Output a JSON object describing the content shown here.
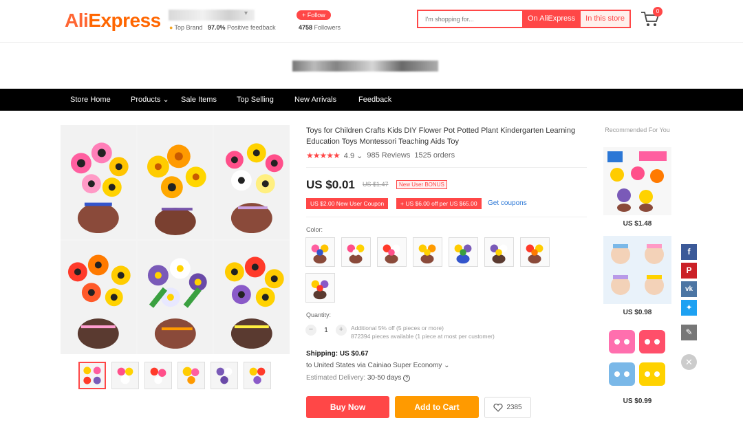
{
  "header": {
    "logo_part1": "Ali",
    "logo_part2": "Express",
    "store_caret": "▾",
    "top_brand": "Top Brand",
    "positive_pct": "97.0%",
    "positive_label": "Positive feedback",
    "follow_label": "+ Follow",
    "followers_count": "4758",
    "followers_label": "Followers",
    "search_placeholder": "I'm shopping for...",
    "on_aliexpress": "On AliExpress",
    "in_this_store": "In this store",
    "cart_count": "0"
  },
  "nav": {
    "items": [
      "Store Home",
      "Products",
      "Sale Items",
      "Top Selling",
      "New Arrivals",
      "Feedback"
    ]
  },
  "product": {
    "title": "Toys for Children Crafts Kids DIY Flower Pot Potted Plant Kindergarten Learning Education Toys Montessori Teaching Aids Toy",
    "stars": "★★★★★",
    "rating": "4.9",
    "reviews": "985 Reviews",
    "orders": "1525 orders",
    "price": "US $0.01",
    "old_price": "US $1.47",
    "bonus": "New User BONUS",
    "coupon_new_user": "US $2.00 New User Coupon",
    "coupon_off": "+ US $6.00 off per US $65.00",
    "get_coupons": "Get coupons",
    "color_label": "Color:",
    "quantity_label": "Quantity:",
    "quantity": "1",
    "qty_note1": "Additional 5% off (5 pieces or more)",
    "qty_note2": "872394 pieces available (1 piece at most per customer)",
    "shipping": "Shipping: US $0.67",
    "ship_to": "to United States via Cainiao Super Economy ⌄",
    "delivery_label": "Estimated Delivery:",
    "delivery_value": "30-50 days",
    "buy_now": "Buy Now",
    "add_to_cart": "Add to Cart",
    "wishlist_count": "2385"
  },
  "recommended": {
    "title": "Recommended For You",
    "items": [
      {
        "price": "US $1.48"
      },
      {
        "price": "US $0.98"
      },
      {
        "price": "US $0.99"
      }
    ]
  },
  "colors": {
    "accent": "#ff4747",
    "cart_orange": "#ff9a00",
    "link": "#2b77d6",
    "facebook": "#3b5998",
    "pinterest": "#cb2027",
    "vk": "#4c75a3",
    "twitter": "#1da1f2"
  }
}
